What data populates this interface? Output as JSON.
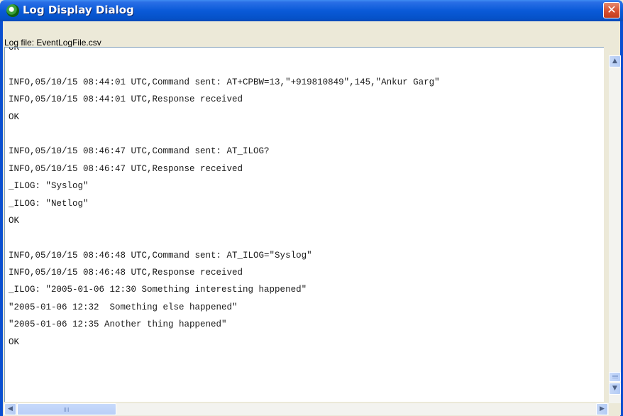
{
  "window": {
    "title": "Log Display Dialog",
    "close_label": "✕"
  },
  "log_file_label": "Log file:  EventLogFile.csv",
  "log": {
    "lines": [
      "OK",
      "",
      "INFO,05/10/15 08:44:01 UTC,Command sent: AT+CPBW=13,\"+919810849\",145,\"Ankur Garg\"",
      "INFO,05/10/15 08:44:01 UTC,Response received",
      "OK",
      "",
      "INFO,05/10/15 08:46:47 UTC,Command sent: AT_ILOG?",
      "INFO,05/10/15 08:46:47 UTC,Response received",
      "_ILOG: \"Syslog\"",
      "_ILOG: \"Netlog\"",
      "OK",
      "",
      "INFO,05/10/15 08:46:48 UTC,Command sent: AT_ILOG=\"Syslog\"",
      "INFO,05/10/15 08:46:48 UTC,Response received",
      "_ILOG: \"2005-01-06 12:30 Something interesting happened\"",
      "\"2005-01-06 12:32  Something else happened\"",
      "\"2005-01-06 12:35 Another thing happened\"",
      "OK"
    ]
  },
  "scrollbars": {
    "up_arrow": "▲",
    "down_arrow": "▼",
    "left_arrow": "◀",
    "right_arrow": "▶"
  }
}
